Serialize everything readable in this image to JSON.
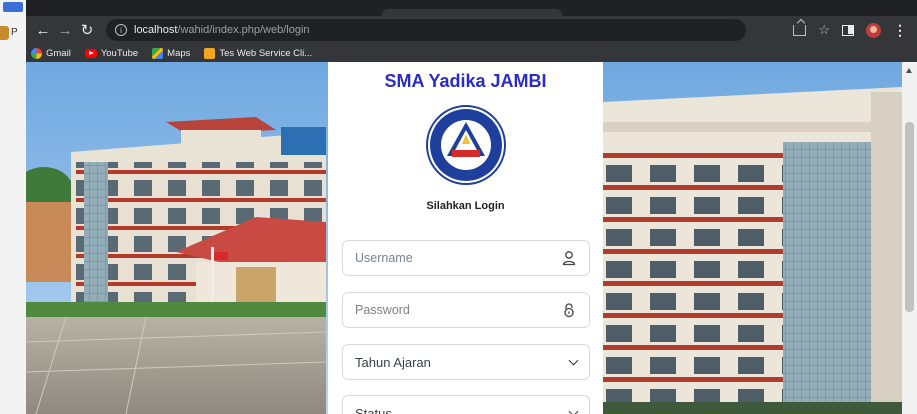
{
  "browser": {
    "url_host": "localhost",
    "url_path": "/wahid/index.php/web/login",
    "bookmarks": [
      {
        "label": "Gmail",
        "icon": "gmail-icon"
      },
      {
        "label": "YouTube",
        "icon": "youtube-icon"
      },
      {
        "label": "Maps",
        "icon": "maps-icon"
      },
      {
        "label": "Tes Web Service Cli...",
        "icon": "bookmark-folder-icon"
      }
    ],
    "left_strip_letter": "P"
  },
  "login": {
    "school_name": "SMA Yadika JAMBI",
    "heading": "Silahkan Login",
    "username_placeholder": "Username",
    "password_placeholder": "Password",
    "tahun_ajaran_label": "Tahun Ajaran",
    "status_label": "Status",
    "logo_text_top": "YAYASAN ABDI KARYA",
    "logo_text_bottom": "JAMBI"
  },
  "colors": {
    "title_color": "#2b2bc6",
    "logo_blue": "#1f3f9c",
    "logo_red": "#d62b2b"
  }
}
